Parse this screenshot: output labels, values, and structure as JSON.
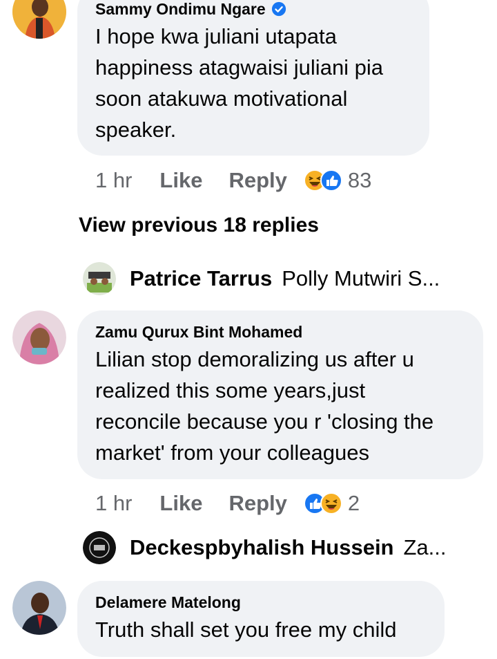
{
  "comments": [
    {
      "author": "Sammy Ondimu Ngare",
      "verified": true,
      "lines": [
        "I hope kwa juliani utapata",
        "happiness atagwaisi juliani pia",
        "soon atakuwa motivational",
        "speaker."
      ],
      "time": "1 hr",
      "like_label": "Like",
      "reply_label": "Reply",
      "reactions": [
        "haha",
        "like"
      ],
      "reaction_count": "83"
    },
    {
      "author": "Zamu Qurux Bint Mohamed",
      "verified": false,
      "lines": [
        "Lilian stop demoralizing us after u",
        "realized this some years,just",
        "reconcile because you r 'closing the",
        "market' from your colleagues"
      ],
      "time": "1 hr",
      "like_label": "Like",
      "reply_label": "Reply",
      "reactions": [
        "like",
        "haha"
      ],
      "reaction_count": "2"
    },
    {
      "author": "Delamere Matelong",
      "verified": false,
      "lines": [
        "Truth shall set you free my child"
      ]
    }
  ],
  "view_previous": "View previous 18 replies",
  "reply_previews": [
    {
      "name": "Patrice Tarrus",
      "text": "Polly Mutwiri S..."
    },
    {
      "name": "Deckespbyhalish Hussein",
      "text": "Za..."
    }
  ],
  "colors": {
    "bubble": "#f0f2f5",
    "meta_text": "#65676b",
    "verified": "#1877f2",
    "like_blue": "#1877f2",
    "haha_yellow": "#f7b125"
  }
}
